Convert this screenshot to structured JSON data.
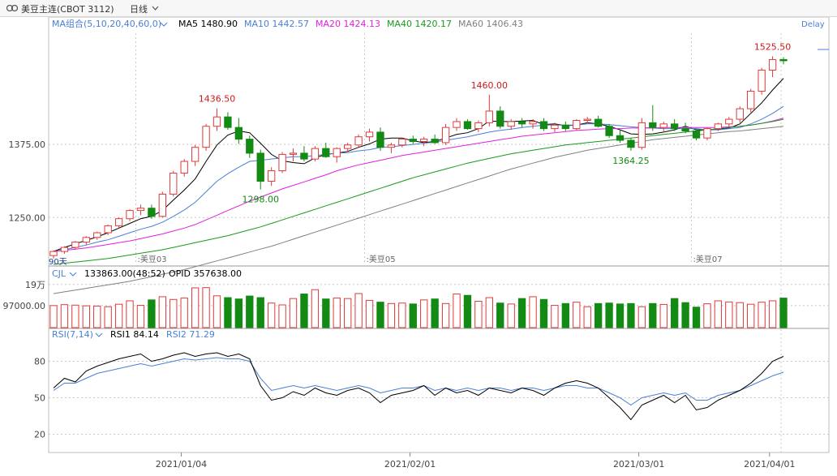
{
  "header": {
    "instrument": "美豆主连(CBOT 3112)",
    "period": "日线",
    "delay": "Delay"
  },
  "ma_legend": {
    "label": "MA组合(5,10,20,40,60,0)",
    "items": [
      {
        "text": "MA5 1480.90",
        "color": "#000000"
      },
      {
        "text": "MA10 1442.57",
        "color": "#4a7fd6"
      },
      {
        "text": "MA20 1424.13",
        "color": "#e020e0"
      },
      {
        "text": "MA40 1420.17",
        "color": "#1a9a1a"
      },
      {
        "text": "MA60 1406.43",
        "color": "#808080"
      }
    ]
  },
  "vol_legend": {
    "label": "CJL",
    "items": [
      {
        "text": "133863.00(48:52)"
      },
      {
        "text": "OPID 357638.00"
      }
    ]
  },
  "rsi_legend": {
    "label": "RSI(7,14)",
    "items": [
      {
        "text": "RSI1 84.14",
        "color": "#000000"
      },
      {
        "text": "RSI2 71.29",
        "color": "#4a7fd6"
      }
    ]
  },
  "colors": {
    "up": "#e03a3a",
    "down": "#138a13",
    "grid": "#c8c8c8",
    "axis": "#444444"
  },
  "chart_data": {
    "type": "candlestick",
    "x_tick_labels": [
      "2021/01/04",
      "2021/02/01",
      "2021/03/01",
      "2021/04/01"
    ],
    "in_chart_date_labels": [
      "美豆03",
      "美豆05",
      "美豆07"
    ],
    "period_marker": "90天",
    "price_axis": {
      "ticks": [
        "1375.00",
        "1250.00"
      ],
      "ylim": [
        1170,
        1565
      ]
    },
    "volume_axis": {
      "ticks": [
        "19万",
        "97000.00"
      ],
      "ylim": [
        0,
        200000
      ]
    },
    "rsi_axis": {
      "ticks": [
        "80",
        "50",
        "20"
      ],
      "ylim": [
        5,
        95
      ]
    },
    "annotations": [
      {
        "text": "1436.50",
        "index": 15,
        "value": 1436.5,
        "kind": "high"
      },
      {
        "text": "1298.00",
        "index": 19,
        "value": 1298.0,
        "kind": "low"
      },
      {
        "text": "1460.00",
        "index": 40,
        "value": 1460.0,
        "kind": "high"
      },
      {
        "text": "1364.25",
        "index": 53,
        "value": 1364.25,
        "kind": "low"
      },
      {
        "text": "1525.50",
        "index": 66,
        "value": 1525.5,
        "kind": "high"
      }
    ],
    "candles": [
      [
        1185,
        1194,
        1180,
        1192
      ],
      [
        1192,
        1201,
        1188,
        1199
      ],
      [
        1199,
        1210,
        1195,
        1208
      ],
      [
        1208,
        1218,
        1203,
        1216
      ],
      [
        1216,
        1226,
        1212,
        1224
      ],
      [
        1224,
        1238,
        1220,
        1236
      ],
      [
        1236,
        1250,
        1232,
        1248
      ],
      [
        1248,
        1264,
        1244,
        1262
      ],
      [
        1262,
        1272,
        1254,
        1266
      ],
      [
        1266,
        1272,
        1248,
        1252
      ],
      [
        1252,
        1294,
        1250,
        1290
      ],
      [
        1290,
        1330,
        1286,
        1326
      ],
      [
        1326,
        1350,
        1320,
        1346
      ],
      [
        1346,
        1374,
        1338,
        1370
      ],
      [
        1370,
        1410,
        1364,
        1406
      ],
      [
        1406,
        1436.5,
        1398,
        1422
      ],
      [
        1422,
        1430,
        1400,
        1404
      ],
      [
        1404,
        1420,
        1376,
        1384
      ],
      [
        1384,
        1390,
        1352,
        1360
      ],
      [
        1360,
        1366,
        1298,
        1312
      ],
      [
        1312,
        1336,
        1304,
        1330
      ],
      [
        1330,
        1362,
        1326,
        1358
      ],
      [
        1358,
        1368,
        1346,
        1360
      ],
      [
        1360,
        1372,
        1346,
        1350
      ],
      [
        1350,
        1372,
        1346,
        1368
      ],
      [
        1368,
        1378,
        1352,
        1354
      ],
      [
        1354,
        1370,
        1344,
        1368
      ],
      [
        1368,
        1378,
        1362,
        1374
      ],
      [
        1374,
        1392,
        1370,
        1388
      ],
      [
        1388,
        1402,
        1380,
        1396
      ],
      [
        1396,
        1404,
        1364,
        1370
      ],
      [
        1370,
        1378,
        1360,
        1374
      ],
      [
        1374,
        1386,
        1370,
        1384
      ],
      [
        1384,
        1390,
        1376,
        1380
      ],
      [
        1380,
        1388,
        1372,
        1384
      ],
      [
        1384,
        1392,
        1376,
        1378
      ],
      [
        1378,
        1410,
        1374,
        1404
      ],
      [
        1404,
        1420,
        1398,
        1414
      ],
      [
        1414,
        1418,
        1400,
        1402
      ],
      [
        1402,
        1416,
        1396,
        1412
      ],
      [
        1412,
        1460,
        1406,
        1432
      ],
      [
        1432,
        1440,
        1402,
        1406
      ],
      [
        1406,
        1418,
        1400,
        1414
      ],
      [
        1414,
        1420,
        1404,
        1410
      ],
      [
        1410,
        1418,
        1402,
        1414
      ],
      [
        1414,
        1420,
        1398,
        1402
      ],
      [
        1402,
        1412,
        1396,
        1408
      ],
      [
        1408,
        1414,
        1398,
        1402
      ],
      [
        1402,
        1418,
        1398,
        1416
      ],
      [
        1416,
        1422,
        1410,
        1418
      ],
      [
        1418,
        1424,
        1404,
        1406
      ],
      [
        1406,
        1410,
        1386,
        1390
      ],
      [
        1390,
        1400,
        1378,
        1382
      ],
      [
        1382,
        1386,
        1364.25,
        1370
      ],
      [
        1370,
        1420,
        1366,
        1412
      ],
      [
        1412,
        1442,
        1398,
        1404
      ],
      [
        1404,
        1414,
        1396,
        1410
      ],
      [
        1410,
        1418,
        1398,
        1402
      ],
      [
        1402,
        1412,
        1394,
        1398
      ],
      [
        1398,
        1402,
        1382,
        1386
      ],
      [
        1386,
        1404,
        1382,
        1402
      ],
      [
        1402,
        1412,
        1398,
        1410
      ],
      [
        1410,
        1422,
        1404,
        1418
      ],
      [
        1418,
        1440,
        1412,
        1436
      ],
      [
        1436,
        1470,
        1430,
        1466
      ],
      [
        1466,
        1506,
        1460,
        1502
      ],
      [
        1502,
        1525.5,
        1490,
        1520
      ],
      [
        1520,
        1524,
        1512,
        1518
      ]
    ],
    "ma_series": [
      {
        "name": "MA5",
        "color": "#000000",
        "values": [
          1192,
          1199,
          1205,
          1211,
          1217,
          1224,
          1232,
          1240,
          1248,
          1252,
          1262,
          1280,
          1297,
          1316,
          1346,
          1374,
          1391,
          1398,
          1395,
          1377,
          1358,
          1347,
          1344,
          1342,
          1352,
          1358,
          1360,
          1363,
          1370,
          1376,
          1384,
          1386,
          1386,
          1381,
          1378,
          1380,
          1386,
          1392,
          1395,
          1402,
          1415,
          1414,
          1414,
          1415,
          1416,
          1409,
          1410,
          1407,
          1408,
          1412,
          1410,
          1406,
          1400,
          1393,
          1392,
          1393,
          1396,
          1400,
          1406,
          1400,
          1400,
          1401,
          1403,
          1410,
          1428,
          1446,
          1468,
          1488
        ]
      },
      {
        "name": "MA10",
        "color": "#4a7fd6",
        "values": [
          1192,
          1195,
          1199,
          1203,
          1208,
          1212,
          1218,
          1224,
          1230,
          1235,
          1242,
          1252,
          1263,
          1276,
          1294,
          1312,
          1325,
          1336,
          1346,
          1348,
          1350,
          1352,
          1354,
          1354,
          1356,
          1358,
          1360,
          1361,
          1364,
          1366,
          1370,
          1371,
          1373,
          1375,
          1377,
          1379,
          1382,
          1385,
          1388,
          1392,
          1396,
          1399,
          1401,
          1404,
          1406,
          1408,
          1408,
          1408,
          1408,
          1410,
          1410,
          1409,
          1407,
          1405,
          1404,
          1403,
          1402,
          1402,
          1402,
          1402,
          1400,
          1400,
          1402,
          1404,
          1410,
          1418,
          1428,
          1440
        ]
      },
      {
        "name": "MA20",
        "color": "#e020e0",
        "values": [
          1192,
          1194,
          1196,
          1198,
          1201,
          1204,
          1207,
          1210,
          1214,
          1218,
          1222,
          1227,
          1232,
          1238,
          1246,
          1254,
          1262,
          1270,
          1278,
          1285,
          1292,
          1299,
          1305,
          1311,
          1317,
          1323,
          1330,
          1335,
          1340,
          1344,
          1348,
          1352,
          1356,
          1359,
          1362,
          1365,
          1368,
          1371,
          1374,
          1377,
          1380,
          1383,
          1386,
          1389,
          1391,
          1393,
          1395,
          1397,
          1399,
          1400,
          1401,
          1402,
          1402,
          1403,
          1403,
          1403,
          1404,
          1404,
          1404,
          1404,
          1404,
          1404,
          1405,
          1406,
          1408,
          1411,
          1415,
          1420
        ]
      },
      {
        "name": "MA40",
        "color": "#1a9a1a",
        "values": [
          1170,
          1172,
          1174,
          1176,
          1178,
          1180,
          1183,
          1186,
          1189,
          1192,
          1195,
          1199,
          1203,
          1207,
          1211,
          1215,
          1219,
          1224,
          1229,
          1234,
          1240,
          1246,
          1252,
          1258,
          1264,
          1270,
          1276,
          1282,
          1288,
          1294,
          1300,
          1306,
          1312,
          1318,
          1323,
          1328,
          1333,
          1338,
          1343,
          1347,
          1351,
          1355,
          1359,
          1362,
          1365,
          1368,
          1371,
          1374,
          1376,
          1378,
          1380,
          1382,
          1384,
          1386,
          1388,
          1390,
          1392,
          1394,
          1396,
          1398,
          1400,
          1402,
          1404,
          1406,
          1408,
          1411,
          1414,
          1418
        ]
      },
      {
        "name": "MA60",
        "color": "#808080",
        "values": [
          1120,
          1123,
          1126,
          1129,
          1132,
          1135,
          1138,
          1141,
          1145,
          1149,
          1153,
          1157,
          1161,
          1166,
          1171,
          1176,
          1181,
          1186,
          1191,
          1196,
          1201,
          1207,
          1213,
          1219,
          1225,
          1231,
          1237,
          1243,
          1249,
          1255,
          1261,
          1267,
          1273,
          1279,
          1285,
          1291,
          1297,
          1303,
          1309,
          1315,
          1321,
          1327,
          1333,
          1338,
          1343,
          1348,
          1353,
          1357,
          1361,
          1365,
          1368,
          1371,
          1374,
          1377,
          1380,
          1383,
          1385,
          1387,
          1389,
          1391,
          1393,
          1395,
          1397,
          1398,
          1400,
          1402,
          1404,
          1406
        ]
      }
    ],
    "volume": [
      97000,
      101000,
      99000,
      96000,
      95000,
      92000,
      103000,
      118000,
      98000,
      122000,
      136000,
      124000,
      130000,
      175000,
      176000,
      140000,
      132000,
      126000,
      139000,
      132000,
      108000,
      100000,
      128000,
      148000,
      167000,
      126000,
      130000,
      128000,
      150000,
      120000,
      112000,
      106000,
      108000,
      104000,
      122000,
      126000,
      106000,
      148000,
      142000,
      116000,
      132000,
      108000,
      104000,
      128000,
      136000,
      124000,
      98000,
      106000,
      112000,
      92000,
      106000,
      108000,
      104000,
      106000,
      92000,
      106000,
      102000,
      128000,
      110000,
      90000,
      105000,
      118000,
      113000,
      110000,
      103000,
      112000,
      118000,
      130000
    ],
    "rsi1": [
      58,
      66,
      63,
      72,
      76,
      79,
      82,
      84,
      86,
      80,
      82,
      85,
      87,
      84,
      86,
      87,
      84,
      86,
      82,
      60,
      48,
      50,
      55,
      52,
      58,
      54,
      52,
      56,
      58,
      54,
      46,
      52,
      54,
      56,
      60,
      52,
      58,
      54,
      56,
      52,
      58,
      56,
      54,
      58,
      56,
      52,
      58,
      62,
      64,
      62,
      58,
      50,
      42,
      32,
      44,
      48,
      52,
      46,
      52,
      40,
      42,
      48,
      52,
      56,
      62,
      70,
      80,
      84
    ],
    "rsi2": [
      56,
      62,
      62,
      66,
      70,
      72,
      74,
      76,
      78,
      76,
      78,
      80,
      82,
      81,
      82,
      83,
      82,
      82,
      80,
      66,
      56,
      58,
      60,
      58,
      60,
      58,
      56,
      58,
      60,
      58,
      54,
      56,
      58,
      58,
      60,
      56,
      58,
      56,
      58,
      56,
      58,
      58,
      56,
      58,
      58,
      56,
      58,
      60,
      60,
      58,
      58,
      54,
      50,
      44,
      50,
      52,
      54,
      52,
      54,
      48,
      48,
      52,
      54,
      56,
      60,
      64,
      68,
      71
    ]
  }
}
